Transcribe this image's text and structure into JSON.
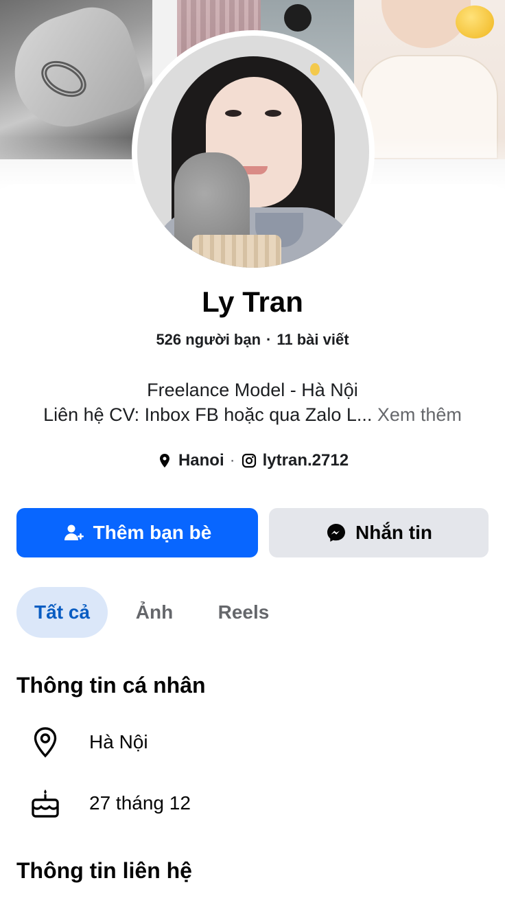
{
  "profile": {
    "name": "Ly Tran",
    "friends": "526 người bạn",
    "posts": "11 bài viết",
    "bio_line1": "Freelance Model - Hà Nội",
    "bio_line2": "Liên hệ CV: Inbox FB hoặc qua Zalo L...",
    "see_more": "Xem thêm"
  },
  "links": {
    "location": "Hanoi",
    "instagram": "lytran.2712"
  },
  "actions": {
    "add_friend": "Thêm bạn bè",
    "message": "Nhắn tin"
  },
  "tabs": [
    {
      "label": "Tất cả",
      "active": true
    },
    {
      "label": "Ảnh",
      "active": false
    },
    {
      "label": "Reels",
      "active": false
    }
  ],
  "personal_info": {
    "title": "Thông tin cá nhân",
    "location": "Hà Nội",
    "birthday": "27 tháng 12"
  },
  "contact_info": {
    "title": "Thông tin liên hệ"
  },
  "icons": {
    "location": "location-pin-icon",
    "instagram": "instagram-icon",
    "add_friend": "add-friend-icon",
    "messenger": "messenger-icon",
    "birthday": "birthday-cake-icon"
  },
  "colors": {
    "primary": "#0866ff",
    "secondary_button": "#e4e6eb",
    "active_tab_bg": "#dbe7f9",
    "active_tab_text": "#0a5dc2",
    "muted_text": "#65676b"
  }
}
